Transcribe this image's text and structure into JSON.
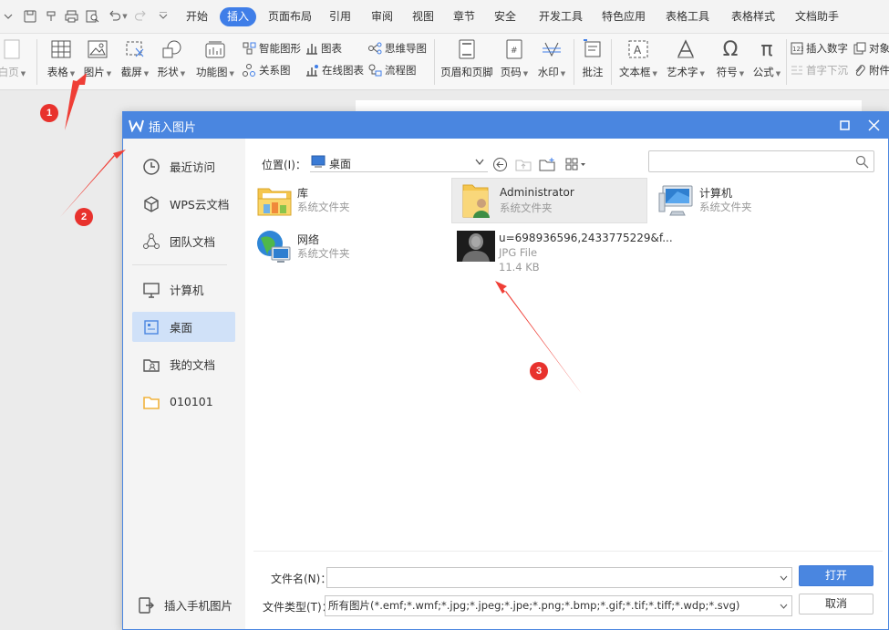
{
  "menubar": {
    "tabs": [
      "开始",
      "插入",
      "页面布局",
      "引用",
      "审阅",
      "视图",
      "章节",
      "安全",
      "开发工具",
      "特色应用",
      "表格工具",
      "表格样式",
      "文档助手"
    ],
    "active_tab": "插入"
  },
  "ribbon": {
    "blank_page": "白页",
    "table": "表格",
    "picture": "图片",
    "screenshot": "截屏",
    "shape": "形状",
    "function_chart": "功能图",
    "smart_art": "智能图形",
    "chart": "图表",
    "relation_chart": "关系图",
    "online_chart": "在线图表",
    "mind_map": "思维导图",
    "flow_chart": "流程图",
    "header_footer": "页眉和页脚",
    "page_number": "页码",
    "watermark": "水印",
    "comment": "批注",
    "text_box": "文本框",
    "word_art": "艺术字",
    "symbol": "符号",
    "formula": "公式",
    "insert_number": "插入数字",
    "drop_cap": "首字下沉",
    "object": "对象",
    "attachment": "附件"
  },
  "annotations": [
    "1",
    "2",
    "3"
  ],
  "dialog": {
    "title": "插入图片",
    "sidebar": [
      {
        "label": "最近访问"
      },
      {
        "label": "WPS云文档"
      },
      {
        "label": "团队文档"
      },
      {
        "label": "计算机"
      },
      {
        "label": "桌面"
      },
      {
        "label": "我的文档"
      },
      {
        "label": "010101"
      }
    ],
    "mobile_insert": "插入手机图片",
    "location_label": "位置(I)：",
    "location_value": "桌面",
    "search_placeholder": "",
    "files": [
      {
        "name": "库",
        "type": "系统文件夹"
      },
      {
        "name": "Administrator",
        "type": "系统文件夹"
      },
      {
        "name": "计算机",
        "type": "系统文件夹"
      },
      {
        "name": "网络",
        "type": "系统文件夹"
      },
      {
        "name": "u=698936596,2433775229&f...",
        "type": "JPG File",
        "size": "11.4 KB"
      }
    ],
    "filename_label": "文件名(N)：",
    "filename_value": "",
    "filetype_label": "文件类型(T)：",
    "filetype_value": "所有图片(*.emf;*.wmf;*.jpg;*.jpeg;*.jpe;*.png;*.bmp;*.gif;*.tif;*.tiff;*.wdp;*.svg)",
    "open_button": "打开",
    "cancel_button": "取消"
  },
  "colors": {
    "accent": "#4a86e0",
    "annotation_red": "#e8322d"
  }
}
